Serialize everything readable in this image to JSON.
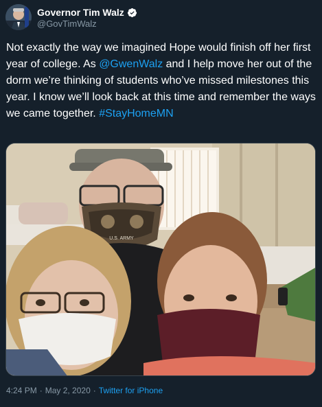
{
  "author": {
    "display_name": "Governor Tim Walz",
    "handle": "@GovTimWalz",
    "verified_icon": "verified-badge-icon",
    "avatar_icon": "profile-avatar"
  },
  "tweet": {
    "text_1": "Not exactly the way we imagined Hope would finish off her first year of college. As ",
    "mention": "@GwenWalz",
    "text_2": " and I help move her out of the dorm we’re thinking of students who’ve missed milestones this year. I know we’ll look back at this time and remember the ways we came together. ",
    "hashtag": "#StayHomeMN"
  },
  "photo": {
    "icon": "dorm-selfie-photo",
    "mask_text": "U.S. ARMY"
  },
  "footer": {
    "time": "4:24 PM",
    "separator": "·",
    "date": "May 2, 2020",
    "source": "Twitter for iPhone"
  },
  "colors": {
    "background": "#15202b",
    "link": "#1da1f2",
    "secondary_text": "#8899a6",
    "border": "#38444d"
  }
}
